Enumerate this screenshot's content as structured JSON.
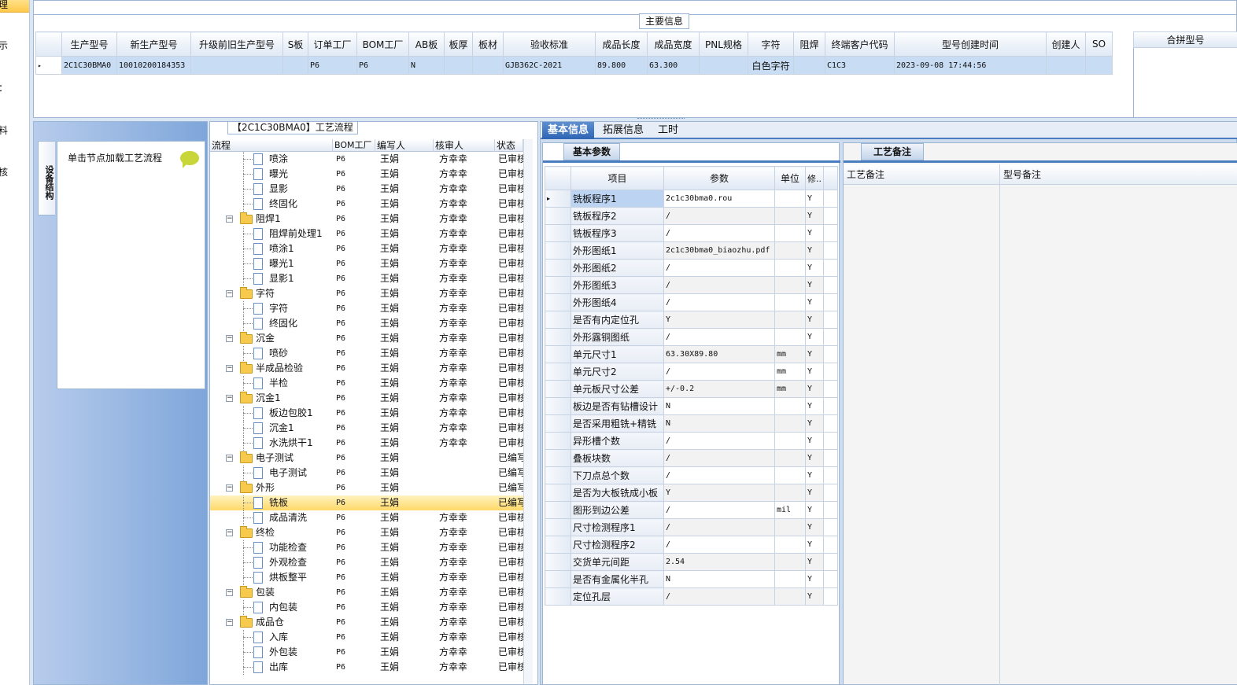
{
  "leftnav": [
    "理",
    "示",
    "：",
    "料",
    "核"
  ],
  "main_info": {
    "title": "主要信息",
    "columns": [
      "生产型号",
      "新生产型号",
      "升级前旧生产型号",
      "S板",
      "订单工厂",
      "BOM工厂",
      "AB板",
      "板厚",
      "板材",
      "验收标准",
      "成品长度",
      "成品宽度",
      "PNL规格",
      "字符",
      "阻焊",
      "终端客户代码",
      "型号创建时间",
      "创建人",
      "SO"
    ],
    "row": [
      "2C1C30BMA0",
      "10010200184353",
      "",
      "",
      "P6",
      "P6",
      "N",
      "",
      "",
      "GJB362C-2021",
      "89.800",
      "63.300",
      "",
      "白色字符",
      "",
      "C1C3",
      "2023-09-08 17:44:56",
      "",
      ""
    ],
    "merge_header": "合拼型号"
  },
  "left_panel": {
    "vtab": "设备结构",
    "hint": "单击节点加载工艺流程"
  },
  "process": {
    "title": "【2C1C30BMA0】工艺流程",
    "headers": [
      "流程",
      "BOM工厂",
      "编写人",
      "核审人",
      "状态"
    ],
    "rows": [
      {
        "name": "喷涂",
        "level": 1,
        "bom": "P6",
        "writer": "王娟",
        "reviewer": "方幸幸",
        "status": "已审核"
      },
      {
        "name": "曝光",
        "level": 1,
        "bom": "P6",
        "writer": "王娟",
        "reviewer": "方幸幸",
        "status": "已审核"
      },
      {
        "name": "显影",
        "level": 1,
        "bom": "P6",
        "writer": "王娟",
        "reviewer": "方幸幸",
        "status": "已审核"
      },
      {
        "name": "终固化",
        "level": 1,
        "bom": "P6",
        "writer": "王娟",
        "reviewer": "方幸幸",
        "status": "已审核"
      },
      {
        "name": "阻焊1",
        "level": 0,
        "bom": "P6",
        "writer": "王娟",
        "reviewer": "方幸幸",
        "status": "已审核"
      },
      {
        "name": "阻焊前处理1",
        "level": 1,
        "bom": "P6",
        "writer": "王娟",
        "reviewer": "方幸幸",
        "status": "已审核"
      },
      {
        "name": "喷涂1",
        "level": 1,
        "bom": "P6",
        "writer": "王娟",
        "reviewer": "方幸幸",
        "status": "已审核"
      },
      {
        "name": "曝光1",
        "level": 1,
        "bom": "P6",
        "writer": "王娟",
        "reviewer": "方幸幸",
        "status": "已审核"
      },
      {
        "name": "显影1",
        "level": 1,
        "bom": "P6",
        "writer": "王娟",
        "reviewer": "方幸幸",
        "status": "已审核"
      },
      {
        "name": "字符",
        "level": 0,
        "bom": "P6",
        "writer": "王娟",
        "reviewer": "方幸幸",
        "status": "已审核"
      },
      {
        "name": "字符",
        "level": 1,
        "bom": "P6",
        "writer": "王娟",
        "reviewer": "方幸幸",
        "status": "已审核"
      },
      {
        "name": "终固化",
        "level": 1,
        "bom": "P6",
        "writer": "王娟",
        "reviewer": "方幸幸",
        "status": "已审核"
      },
      {
        "name": "沉金",
        "level": 0,
        "bom": "P6",
        "writer": "王娟",
        "reviewer": "方幸幸",
        "status": "已审核"
      },
      {
        "name": "喷砂",
        "level": 1,
        "bom": "P6",
        "writer": "王娟",
        "reviewer": "方幸幸",
        "status": "已审核"
      },
      {
        "name": "半成品检验",
        "level": 0,
        "bom": "P6",
        "writer": "王娟",
        "reviewer": "方幸幸",
        "status": "已审核"
      },
      {
        "name": "半检",
        "level": 1,
        "bom": "P6",
        "writer": "王娟",
        "reviewer": "方幸幸",
        "status": "已审核"
      },
      {
        "name": "沉金1",
        "level": 0,
        "bom": "P6",
        "writer": "王娟",
        "reviewer": "方幸幸",
        "status": "已审核"
      },
      {
        "name": "板边包胶1",
        "level": 1,
        "bom": "P6",
        "writer": "王娟",
        "reviewer": "方幸幸",
        "status": "已审核"
      },
      {
        "name": "沉金1",
        "level": 1,
        "bom": "P6",
        "writer": "王娟",
        "reviewer": "方幸幸",
        "status": "已审核"
      },
      {
        "name": "水洗烘干1",
        "level": 1,
        "bom": "P6",
        "writer": "王娟",
        "reviewer": "方幸幸",
        "status": "已审核"
      },
      {
        "name": "电子测试",
        "level": 0,
        "bom": "P6",
        "writer": "王娟",
        "reviewer": "",
        "status": "已编写"
      },
      {
        "name": "电子测试",
        "level": 1,
        "bom": "P6",
        "writer": "王娟",
        "reviewer": "",
        "status": "已编写"
      },
      {
        "name": "外形",
        "level": 0,
        "bom": "P6",
        "writer": "王娟",
        "reviewer": "",
        "status": "已编写"
      },
      {
        "name": "铣板",
        "level": 1,
        "bom": "P6",
        "writer": "王娟",
        "reviewer": "",
        "status": "已编写",
        "selected": true
      },
      {
        "name": "成品清洗",
        "level": 1,
        "bom": "P6",
        "writer": "王娟",
        "reviewer": "方幸幸",
        "status": "已审核"
      },
      {
        "name": "终检",
        "level": 0,
        "bom": "P6",
        "writer": "王娟",
        "reviewer": "方幸幸",
        "status": "已审核"
      },
      {
        "name": "功能检查",
        "level": 1,
        "bom": "P6",
        "writer": "王娟",
        "reviewer": "方幸幸",
        "status": "已审核"
      },
      {
        "name": "外观检查",
        "level": 1,
        "bom": "P6",
        "writer": "王娟",
        "reviewer": "方幸幸",
        "status": "已审核"
      },
      {
        "name": "烘板整平",
        "level": 1,
        "bom": "P6",
        "writer": "王娟",
        "reviewer": "方幸幸",
        "status": "已审核"
      },
      {
        "name": "包装",
        "level": 0,
        "bom": "P6",
        "writer": "王娟",
        "reviewer": "方幸幸",
        "status": "已审核"
      },
      {
        "name": "内包装",
        "level": 1,
        "bom": "P6",
        "writer": "王娟",
        "reviewer": "方幸幸",
        "status": "已审核"
      },
      {
        "name": "成品仓",
        "level": 0,
        "bom": "P6",
        "writer": "王娟",
        "reviewer": "方幸幸",
        "status": "已审核"
      },
      {
        "name": "入库",
        "level": 1,
        "bom": "P6",
        "writer": "王娟",
        "reviewer": "方幸幸",
        "status": "已审核"
      },
      {
        "name": "外包装",
        "level": 1,
        "bom": "P6",
        "writer": "王娟",
        "reviewer": "方幸幸",
        "status": "已审核"
      },
      {
        "name": "出库",
        "level": 1,
        "bom": "P6",
        "writer": "王娟",
        "reviewer": "方幸幸",
        "status": "已审核"
      }
    ]
  },
  "tabs": [
    "基本信息",
    "拓展信息",
    "工时"
  ],
  "params": {
    "tab": "基本参数",
    "headers": [
      "项目",
      "参数",
      "单位",
      "修.."
    ],
    "rows": [
      {
        "item": "铣板程序1",
        "value": "2c1c30bma0.rou",
        "unit": "",
        "mod": "Y"
      },
      {
        "item": "铣板程序2",
        "value": "/",
        "unit": "",
        "mod": "Y"
      },
      {
        "item": "铣板程序3",
        "value": "/",
        "unit": "",
        "mod": "Y"
      },
      {
        "item": "外形图纸1",
        "value": "2c1c30bma0_biaozhu.pdf",
        "unit": "",
        "mod": "Y"
      },
      {
        "item": "外形图纸2",
        "value": "/",
        "unit": "",
        "mod": "Y"
      },
      {
        "item": "外形图纸3",
        "value": "/",
        "unit": "",
        "mod": "Y"
      },
      {
        "item": "外形图纸4",
        "value": "/",
        "unit": "",
        "mod": "Y"
      },
      {
        "item": "是否有内定位孔",
        "value": "Y",
        "unit": "",
        "mod": "Y"
      },
      {
        "item": "外形露铜图纸",
        "value": "/",
        "unit": "",
        "mod": "Y"
      },
      {
        "item": "单元尺寸1",
        "value": "63.30X89.80",
        "unit": "mm",
        "mod": "Y"
      },
      {
        "item": "单元尺寸2",
        "value": "/",
        "unit": "mm",
        "mod": "Y"
      },
      {
        "item": "单元板尺寸公差",
        "value": "+/-0.2",
        "unit": "mm",
        "mod": "Y"
      },
      {
        "item": "板边是否有钻槽设计",
        "value": "N",
        "unit": "",
        "mod": "Y"
      },
      {
        "item": "是否采用粗铣+精铣",
        "value": "N",
        "unit": "",
        "mod": "Y"
      },
      {
        "item": "异形槽个数",
        "value": "/",
        "unit": "",
        "mod": "Y"
      },
      {
        "item": "叠板块数",
        "value": "/",
        "unit": "",
        "mod": "Y"
      },
      {
        "item": "下刀点总个数",
        "value": "/",
        "unit": "",
        "mod": "Y"
      },
      {
        "item": "是否为大板铣成小板",
        "value": "Y",
        "unit": "",
        "mod": "Y"
      },
      {
        "item": "图形到边公差",
        "value": "/",
        "unit": "mil",
        "mod": "Y"
      },
      {
        "item": "尺寸检测程序1",
        "value": "/",
        "unit": "",
        "mod": "Y"
      },
      {
        "item": "尺寸检测程序2",
        "value": "/",
        "unit": "",
        "mod": "Y"
      },
      {
        "item": "交货单元间距",
        "value": "2.54",
        "unit": "",
        "mod": "Y"
      },
      {
        "item": "是否有金属化半孔",
        "value": "N",
        "unit": "",
        "mod": "Y"
      },
      {
        "item": "定位孔层",
        "value": "/",
        "unit": "",
        "mod": "Y"
      }
    ]
  },
  "notes": {
    "tab": "工艺备注",
    "headers": [
      "工艺备注",
      "型号备注"
    ]
  }
}
